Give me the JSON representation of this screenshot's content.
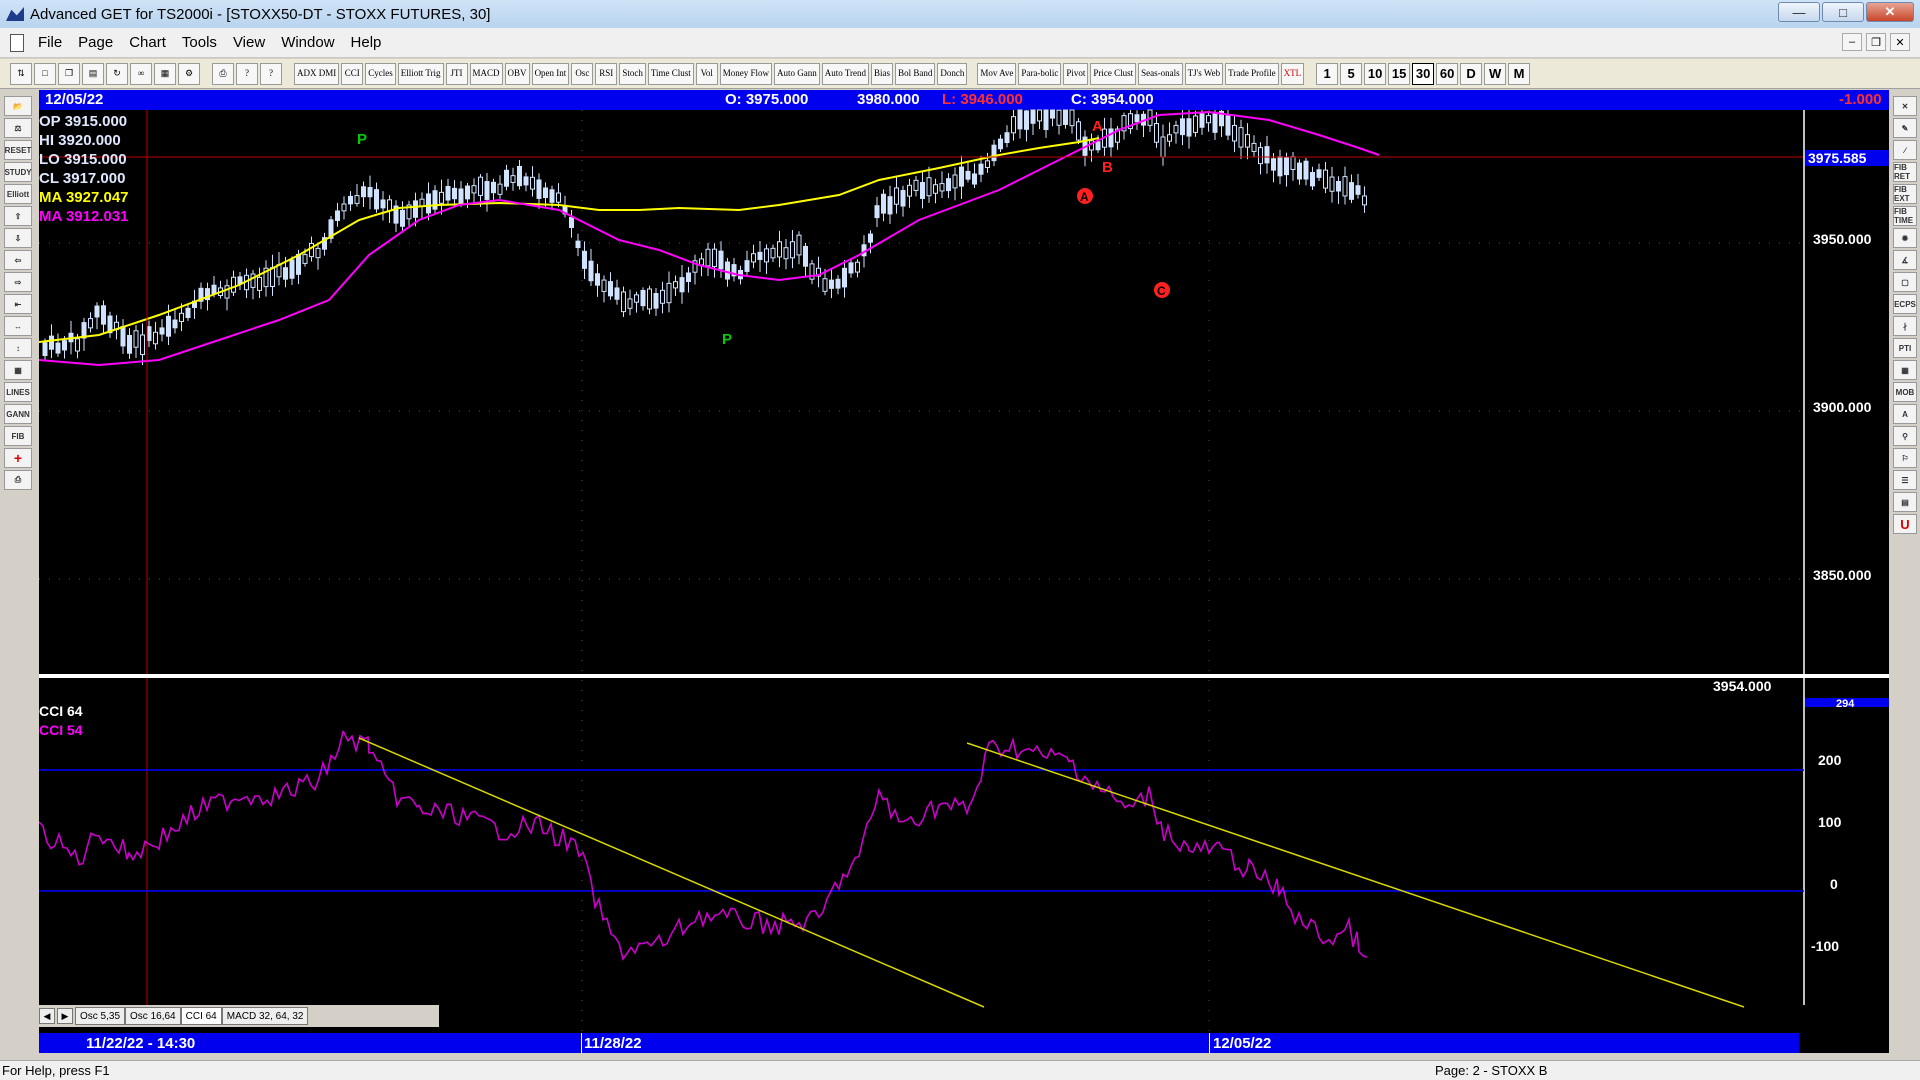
{
  "window": {
    "title": "Advanced GET for TS2000i - [STOXX50-DT - STOXX FUTURES, 30]"
  },
  "menu": [
    "File",
    "Page",
    "Chart",
    "Tools",
    "View",
    "Window",
    "Help"
  ],
  "toolbar": {
    "studies": [
      "ADX DMI",
      "CCI",
      "Cycles",
      "Elliott Trig",
      "JTI",
      "MACD",
      "OBV",
      "Open Int",
      "Osc",
      "RSI",
      "Stoch",
      "Time Clust",
      "Vol",
      "Money Flow",
      "Auto Gann",
      "Auto Trend",
      "Bias",
      "Bol Band",
      "Donch",
      "Mov Ave",
      "Para-bolic",
      "Pivot",
      "Price Clust",
      "Seas-onals",
      "TJ's Web",
      "Trade Profile",
      "XTL"
    ],
    "timeframes": [
      "1",
      "5",
      "10",
      "15",
      "30",
      "60",
      "D",
      "W",
      "M"
    ],
    "selected_timeframe": "30"
  },
  "left_tools": [
    "RESET",
    "STUDY",
    "Elliott",
    "LINES",
    "GANN",
    "FIB"
  ],
  "right_tools": [
    "FIB RET",
    "FIB EXT",
    "FIB TIME",
    "ECPS",
    "PTI",
    "MOB",
    "A",
    "U"
  ],
  "info": {
    "date": "12/05/22",
    "open_label": "O: 3975.000",
    "high_label": "3980.000",
    "low_label": "L: 3946.000",
    "close_label": "C: 3954.000",
    "change_label": "-1.000"
  },
  "legend": {
    "op": "OP  3915.000",
    "hi": "HI   3920.000",
    "lo": "LO  3915.000",
    "cl": "CL  3917.000",
    "ma1": "MA  3927.047",
    "ma2": "MA  3912.031"
  },
  "price_marker": "3975.585",
  "last_price": "3954.000",
  "price_axis": [
    "3950.000",
    "3900.000",
    "3850.000"
  ],
  "cci": {
    "label1": "CCI 64",
    "label2": "CCI  54",
    "axis_top": "294",
    "axis": [
      "200",
      "100",
      "0",
      "-100"
    ]
  },
  "dates": {
    "start": "11/22/22 - 14:30",
    "mid": "11/28/22",
    "end": "12/05/22"
  },
  "tabs": [
    "Osc 5,35",
    "Osc 16,64",
    "CCI 64",
    "MACD 32, 64, 32"
  ],
  "status": {
    "help": "For Help, press F1",
    "page": "Page: 2 - STOXX B"
  },
  "annotations": {
    "p1": "P",
    "p2": "P",
    "a1": "A",
    "b": "B",
    "a2": "A",
    "c": "C"
  },
  "colors": {
    "background": "#000000",
    "info_bar": "#0000ee",
    "ma_fast": "#ffff00",
    "ma_slow": "#ff00ff",
    "candles": "#d0e4ff",
    "cci": "#cc00cc",
    "trendline": "#d8d800"
  }
}
